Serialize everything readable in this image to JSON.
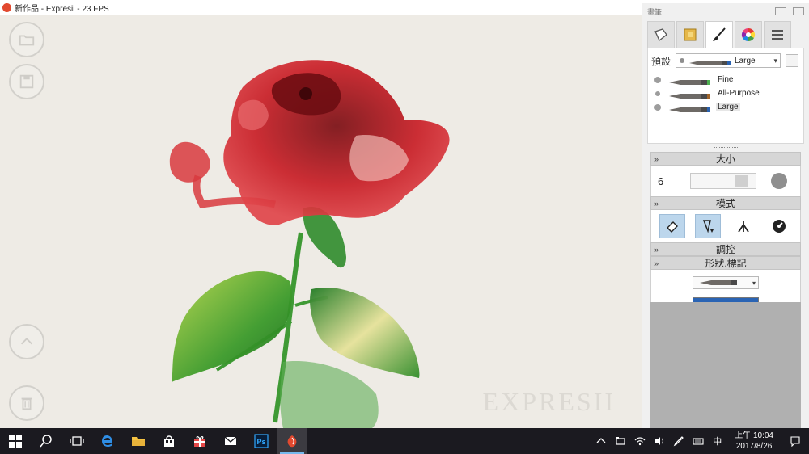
{
  "window": {
    "title": "新作品 - Expresii - 23 FPS"
  },
  "canvas": {
    "watermark": "EXPRESII",
    "side_buttons": [
      {
        "icon": "folder-open-icon"
      },
      {
        "icon": "save-icon"
      },
      {
        "icon": "collapse-up-icon"
      },
      {
        "icon": "trash-icon"
      }
    ]
  },
  "panel": {
    "title": "畫筆",
    "tabs": [
      "paper-tab-icon",
      "layer-tab-icon",
      "brush-tab-icon",
      "color-wheel-tab-icon",
      "menu-tab-icon"
    ],
    "preset_label": "預設",
    "preset_selected": "Large",
    "brushes": [
      {
        "name": "Fine",
        "color": "#4caf50"
      },
      {
        "name": "All-Purpose",
        "color": "#a0642a"
      },
      {
        "name": "Large",
        "color": "#2a62b0"
      }
    ],
    "sections": {
      "size": {
        "title": "大小",
        "value": "6"
      },
      "mode": {
        "title": "模式"
      },
      "control": {
        "title": "調控"
      },
      "shape": {
        "title": "形狀.標記"
      }
    },
    "brush_color": "#2a64b4"
  },
  "taskbar": {
    "input_indicator": "中",
    "time": "上午 10:04",
    "date": "2017/8/26"
  }
}
